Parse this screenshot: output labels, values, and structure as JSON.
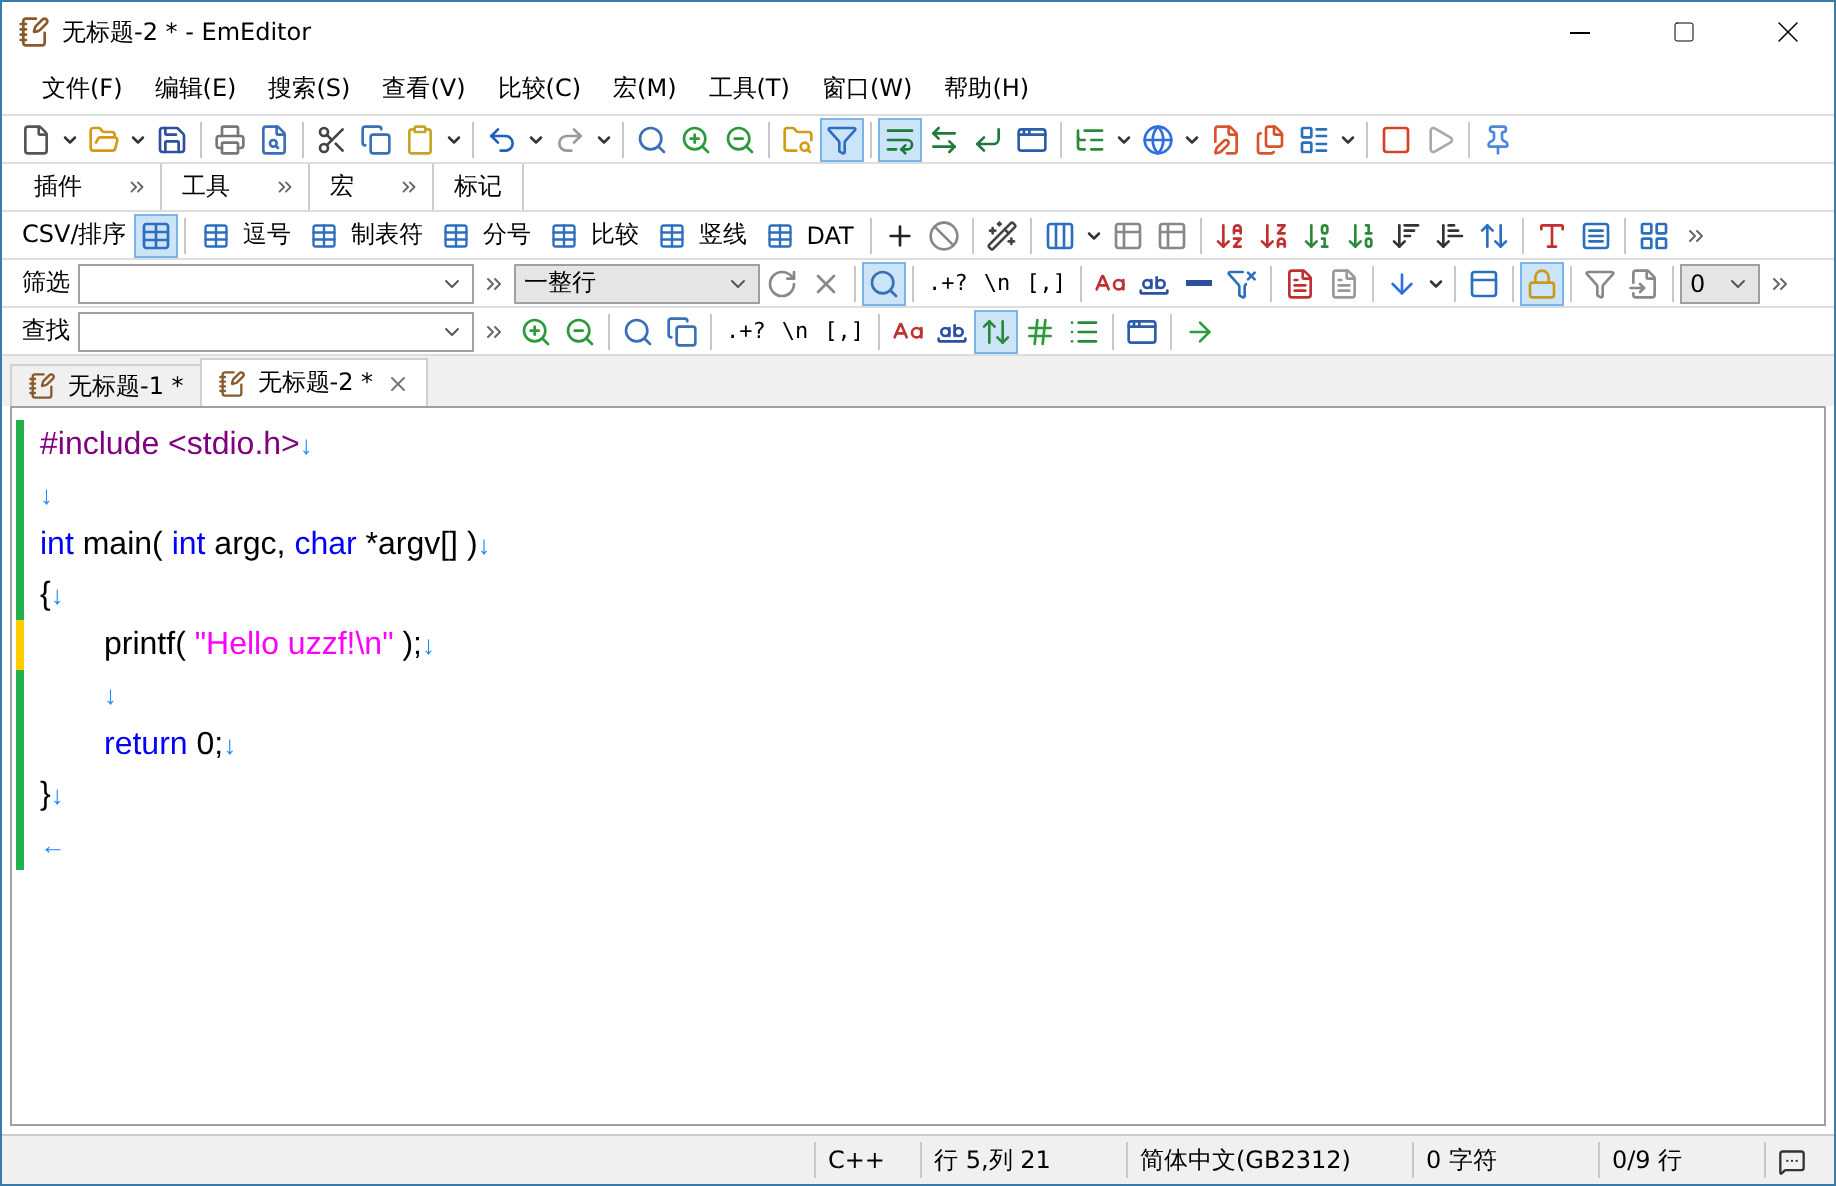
{
  "window": {
    "title": "无标题-2 * - EmEditor"
  },
  "menu": [
    "文件(F)",
    "编辑(E)",
    "搜索(S)",
    "查看(V)",
    "比较(C)",
    "宏(M)",
    "工具(T)",
    "窗口(W)",
    "帮助(H)"
  ],
  "main_toolbar": [
    {
      "kind": "icon",
      "pressed": false
    },
    {
      "kind": "drop"
    },
    {
      "kind": "icon",
      "pressed": false
    },
    {
      "kind": "drop"
    },
    {
      "kind": "icon",
      "pressed": false
    },
    {
      "kind": "sep"
    },
    {
      "kind": "icon",
      "pressed": false
    },
    {
      "kind": "icon",
      "pressed": false
    },
    {
      "kind": "sep"
    },
    {
      "kind": "icon",
      "pressed": false
    },
    {
      "kind": "icon",
      "pressed": false
    },
    {
      "kind": "icon",
      "pressed": false
    },
    {
      "kind": "drop"
    },
    {
      "kind": "sep"
    },
    {
      "kind": "icon",
      "pressed": false
    },
    {
      "kind": "drop"
    },
    {
      "kind": "icon",
      "pressed": false
    },
    {
      "kind": "drop"
    },
    {
      "kind": "sep"
    },
    {
      "kind": "icon",
      "pressed": false
    },
    {
      "kind": "icon",
      "pressed": false
    },
    {
      "kind": "icon",
      "pressed": false
    },
    {
      "kind": "sep"
    },
    {
      "kind": "icon",
      "pressed": false
    },
    {
      "kind": "icon",
      "pressed": true
    },
    {
      "kind": "sep"
    },
    {
      "kind": "icon",
      "pressed": true
    },
    {
      "kind": "icon",
      "pressed": false
    },
    {
      "kind": "icon",
      "pressed": false
    },
    {
      "kind": "icon",
      "pressed": false
    },
    {
      "kind": "sep"
    },
    {
      "kind": "icon",
      "pressed": false
    },
    {
      "kind": "drop"
    },
    {
      "kind": "icon",
      "pressed": false
    },
    {
      "kind": "drop"
    },
    {
      "kind": "icon",
      "pressed": false
    },
    {
      "kind": "icon",
      "pressed": false
    },
    {
      "kind": "icon",
      "pressed": false
    },
    {
      "kind": "drop"
    },
    {
      "kind": "sep"
    },
    {
      "kind": "icon",
      "pressed": false
    },
    {
      "kind": "icon",
      "pressed": false
    },
    {
      "kind": "sep"
    },
    {
      "kind": "icon",
      "pressed": false
    }
  ],
  "toolbar_bands": [
    "插件",
    "工具",
    "宏",
    "标记"
  ],
  "csv_toolbar": [
    {
      "kind": "label",
      "text": "CSV/排序"
    },
    {
      "kind": "icon",
      "pressed": true
    },
    {
      "kind": "sep"
    },
    {
      "kind": "tab",
      "text": "逗号"
    },
    {
      "kind": "tab",
      "text": "制表符"
    },
    {
      "kind": "tab",
      "text": "分号"
    },
    {
      "kind": "tab",
      "text": "比较"
    },
    {
      "kind": "tab",
      "text": "竖线"
    },
    {
      "kind": "tab",
      "text": "DAT"
    },
    {
      "kind": "sep"
    },
    {
      "kind": "icon",
      "pressed": false
    },
    {
      "kind": "icon",
      "pressed": false
    },
    {
      "kind": "sep"
    },
    {
      "kind": "icon",
      "pressed": false
    },
    {
      "kind": "sep"
    },
    {
      "kind": "icon",
      "pressed": false
    },
    {
      "kind": "drop"
    },
    {
      "kind": "icon",
      "pressed": false
    },
    {
      "kind": "icon",
      "pressed": false
    },
    {
      "kind": "sep"
    },
    {
      "kind": "icon",
      "pressed": false
    },
    {
      "kind": "icon",
      "pressed": false
    },
    {
      "kind": "icon",
      "pressed": false
    },
    {
      "kind": "icon",
      "pressed": false
    },
    {
      "kind": "icon",
      "pressed": false
    },
    {
      "kind": "icon",
      "pressed": false
    },
    {
      "kind": "icon",
      "pressed": false
    },
    {
      "kind": "sep"
    },
    {
      "kind": "icon",
      "pressed": false
    },
    {
      "kind": "icon",
      "pressed": false
    },
    {
      "kind": "sep"
    },
    {
      "kind": "icon",
      "pressed": false
    },
    {
      "kind": "more"
    }
  ],
  "filter_toolbar": [
    {
      "kind": "label",
      "text": "筛选"
    },
    {
      "kind": "combo"
    },
    {
      "kind": "more"
    },
    {
      "kind": "select",
      "value": "一整行"
    },
    {
      "kind": "icon",
      "pressed": false
    },
    {
      "kind": "icon",
      "pressed": false
    },
    {
      "kind": "sep"
    },
    {
      "kind": "icon",
      "pressed": true
    },
    {
      "kind": "sep"
    },
    {
      "kind": "text",
      "text": ".+?"
    },
    {
      "kind": "text",
      "text": "\\n"
    },
    {
      "kind": "text",
      "text": "[,]"
    },
    {
      "kind": "sep"
    },
    {
      "kind": "icon",
      "pressed": false
    },
    {
      "kind": "icon",
      "pressed": false
    },
    {
      "kind": "icon",
      "pressed": false
    },
    {
      "kind": "icon",
      "pressed": false
    },
    {
      "kind": "sep"
    },
    {
      "kind": "icon",
      "pressed": false
    },
    {
      "kind": "icon",
      "pressed": false
    },
    {
      "kind": "sep"
    },
    {
      "kind": "icon",
      "pressed": false
    },
    {
      "kind": "drop"
    },
    {
      "kind": "sep"
    },
    {
      "kind": "icon",
      "pressed": false
    },
    {
      "kind": "sep"
    },
    {
      "kind": "icon",
      "pressed": true
    },
    {
      "kind": "sep"
    },
    {
      "kind": "icon",
      "pressed": false
    },
    {
      "kind": "icon",
      "pressed": false
    },
    {
      "kind": "sep"
    },
    {
      "kind": "select",
      "value": "0"
    },
    {
      "kind": "more"
    }
  ],
  "find_toolbar": [
    {
      "kind": "label",
      "text": "查找"
    },
    {
      "kind": "combo"
    },
    {
      "kind": "more"
    },
    {
      "kind": "icon",
      "pressed": false
    },
    {
      "kind": "icon",
      "pressed": false
    },
    {
      "kind": "sep"
    },
    {
      "kind": "icon",
      "pressed": false
    },
    {
      "kind": "icon",
      "pressed": false
    },
    {
      "kind": "sep"
    },
    {
      "kind": "text",
      "text": ".+?"
    },
    {
      "kind": "text",
      "text": "\\n"
    },
    {
      "kind": "text",
      "text": "[,]"
    },
    {
      "kind": "sep"
    },
    {
      "kind": "icon",
      "pressed": false
    },
    {
      "kind": "icon",
      "pressed": false
    },
    {
      "kind": "icon",
      "pressed": true
    },
    {
      "kind": "icon",
      "pressed": false
    },
    {
      "kind": "icon",
      "pressed": false
    },
    {
      "kind": "sep"
    },
    {
      "kind": "icon",
      "pressed": false
    },
    {
      "kind": "sep"
    },
    {
      "kind": "icon",
      "pressed": false
    }
  ],
  "document_tabs": [
    {
      "label": "无标题-1 *",
      "selected": false
    },
    {
      "label": "无标题-2 *",
      "selected": true
    }
  ],
  "editor_lines": [
    {
      "color": "#22b14c",
      "indented": false,
      "tokens": [
        {
          "kind": "preproc",
          "text": "#include <stdio.h>"
        },
        {
          "kind": "eol",
          "text": "↓"
        }
      ]
    },
    {
      "color": "#22b14c",
      "indented": false,
      "tokens": [
        {
          "kind": "eol",
          "text": "↓"
        }
      ]
    },
    {
      "color": "#22b14c",
      "indented": false,
      "tokens": [
        {
          "kind": "keyword",
          "text": "int"
        },
        {
          "kind": "plain",
          "text": " main( "
        },
        {
          "kind": "keyword",
          "text": "int"
        },
        {
          "kind": "plain",
          "text": " argc, "
        },
        {
          "kind": "keyword",
          "text": "char"
        },
        {
          "kind": "plain",
          "text": " *argv[] )"
        },
        {
          "kind": "eol",
          "text": "↓"
        }
      ]
    },
    {
      "color": "#22b14c",
      "indented": false,
      "tokens": [
        {
          "kind": "plain",
          "text": "{"
        },
        {
          "kind": "eol",
          "text": "↓"
        }
      ]
    },
    {
      "color": "#ffcc00",
      "indented": true,
      "tokens": [
        {
          "kind": "plain",
          "text": "printf( "
        },
        {
          "kind": "string",
          "text": "\"Hello uzzf!\\n\""
        },
        {
          "kind": "plain",
          "text": " );"
        },
        {
          "kind": "eol",
          "text": "↓"
        }
      ]
    },
    {
      "color": "#22b14c",
      "indented": true,
      "tokens": [
        {
          "kind": "eol",
          "text": "↓"
        }
      ]
    },
    {
      "color": "#22b14c",
      "indented": true,
      "tokens": [
        {
          "kind": "keyword",
          "text": "return"
        },
        {
          "kind": "plain",
          "text": " 0;"
        },
        {
          "kind": "eol",
          "text": "↓"
        }
      ]
    },
    {
      "color": "#22b14c",
      "indented": false,
      "tokens": [
        {
          "kind": "plain",
          "text": "}"
        },
        {
          "kind": "eol",
          "text": "↓"
        }
      ]
    },
    {
      "color": "#22b14c",
      "indented": false,
      "tokens": [
        {
          "kind": "eol",
          "text": "←"
        }
      ]
    }
  ],
  "status_bar": [
    "C++",
    "行 5,列 21",
    "简体中文(GB2312)",
    "0 字符",
    "0/9 行"
  ]
}
